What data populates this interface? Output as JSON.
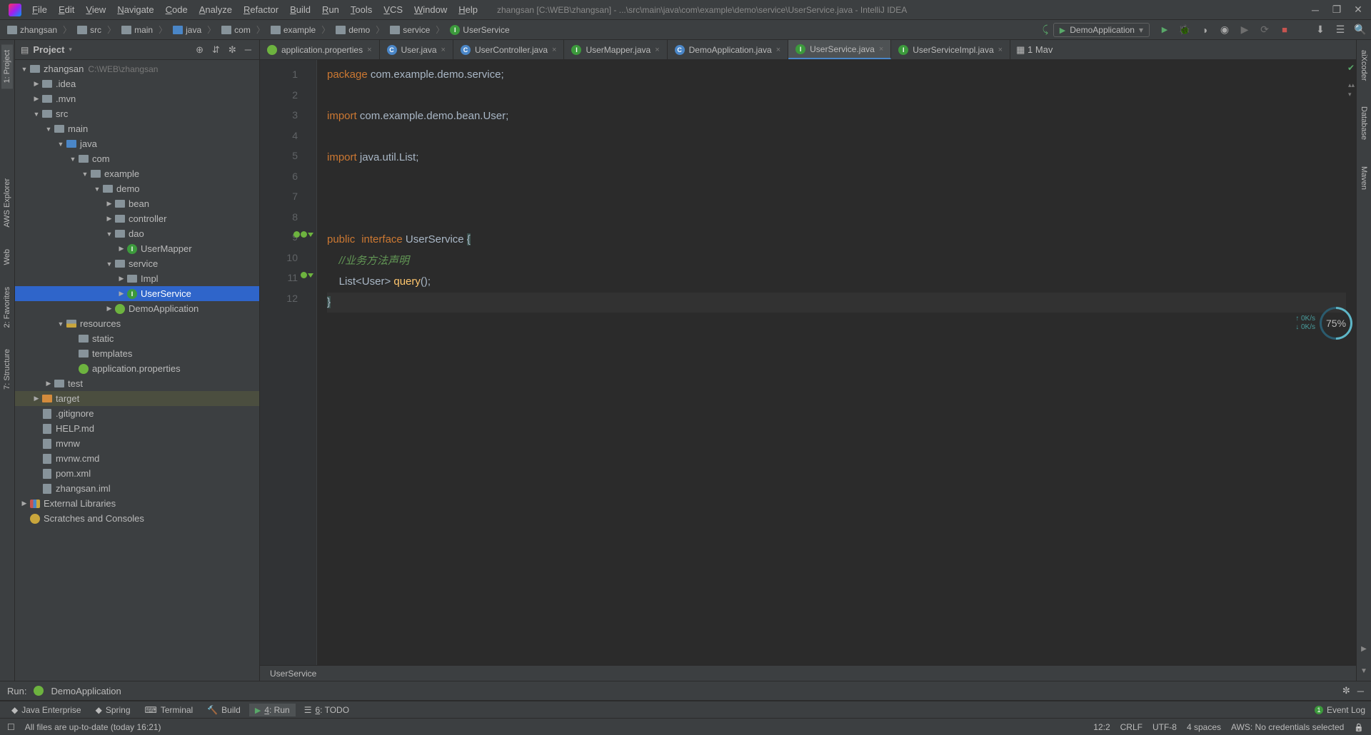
{
  "title": "zhangsan [C:\\WEB\\zhangsan] - ...\\src\\main\\java\\com\\example\\demo\\service\\UserService.java - IntelliJ IDEA",
  "menu": [
    "File",
    "Edit",
    "View",
    "Navigate",
    "Code",
    "Analyze",
    "Refactor",
    "Build",
    "Run",
    "Tools",
    "VCS",
    "Window",
    "Help"
  ],
  "breadcrumbs": [
    "zhangsan",
    "src",
    "main",
    "java",
    "com",
    "example",
    "demo",
    "service",
    "UserService"
  ],
  "runConfig": "DemoApplication",
  "projectPanel": {
    "title": "Project"
  },
  "tree": [
    {
      "d": 0,
      "exp": "down",
      "ico": "dir",
      "label": "zhangsan",
      "dim": "C:\\WEB\\zhangsan"
    },
    {
      "d": 1,
      "exp": "right",
      "ico": "dir",
      "label": ".idea"
    },
    {
      "d": 1,
      "exp": "right",
      "ico": "dir",
      "label": ".mvn"
    },
    {
      "d": 1,
      "exp": "down",
      "ico": "dir",
      "label": "src"
    },
    {
      "d": 2,
      "exp": "down",
      "ico": "dir",
      "label": "main"
    },
    {
      "d": 3,
      "exp": "down",
      "ico": "dir-blue",
      "label": "java"
    },
    {
      "d": 4,
      "exp": "down",
      "ico": "dir",
      "label": "com"
    },
    {
      "d": 5,
      "exp": "down",
      "ico": "dir",
      "label": "example"
    },
    {
      "d": 6,
      "exp": "down",
      "ico": "dir",
      "label": "demo"
    },
    {
      "d": 7,
      "exp": "right",
      "ico": "dir",
      "label": "bean"
    },
    {
      "d": 7,
      "exp": "right",
      "ico": "dir",
      "label": "controller"
    },
    {
      "d": 7,
      "exp": "down",
      "ico": "dir",
      "label": "dao"
    },
    {
      "d": 8,
      "exp": "right",
      "ico": "int",
      "label": "UserMapper"
    },
    {
      "d": 7,
      "exp": "down",
      "ico": "dir",
      "label": "service"
    },
    {
      "d": 8,
      "exp": "right",
      "ico": "dir",
      "label": "Impl"
    },
    {
      "d": 8,
      "exp": "right",
      "ico": "int",
      "label": "UserService",
      "sel": true
    },
    {
      "d": 7,
      "exp": "right",
      "ico": "spring",
      "label": "DemoApplication"
    },
    {
      "d": 3,
      "exp": "down",
      "ico": "res",
      "label": "resources"
    },
    {
      "d": 4,
      "exp": "",
      "ico": "dir",
      "label": "static"
    },
    {
      "d": 4,
      "exp": "",
      "ico": "dir",
      "label": "templates"
    },
    {
      "d": 4,
      "exp": "",
      "ico": "spring",
      "label": "application.properties"
    },
    {
      "d": 2,
      "exp": "right",
      "ico": "dir",
      "label": "test"
    },
    {
      "d": 1,
      "exp": "right",
      "ico": "dir-orange",
      "label": "target",
      "hl": true
    },
    {
      "d": 1,
      "exp": "",
      "ico": "file",
      "label": ".gitignore"
    },
    {
      "d": 1,
      "exp": "",
      "ico": "file",
      "label": "HELP.md"
    },
    {
      "d": 1,
      "exp": "",
      "ico": "file",
      "label": "mvnw"
    },
    {
      "d": 1,
      "exp": "",
      "ico": "file",
      "label": "mvnw.cmd"
    },
    {
      "d": 1,
      "exp": "",
      "ico": "file",
      "label": "pom.xml"
    },
    {
      "d": 1,
      "exp": "",
      "ico": "file",
      "label": "zhangsan.iml"
    },
    {
      "d": 0,
      "exp": "right",
      "ico": "lib",
      "label": "External Libraries"
    },
    {
      "d": 0,
      "exp": "",
      "ico": "scratch",
      "label": "Scratches and Consoles"
    }
  ],
  "tabs": [
    {
      "ico": "spring",
      "label": "application.properties"
    },
    {
      "ico": "class",
      "label": "User.java"
    },
    {
      "ico": "class",
      "label": "UserController.java"
    },
    {
      "ico": "int",
      "label": "UserMapper.java"
    },
    {
      "ico": "class",
      "label": "DemoApplication.java"
    },
    {
      "ico": "int",
      "label": "UserService.java",
      "active": true
    },
    {
      "ico": "int",
      "label": "UserServiceImpl.java"
    }
  ],
  "tabsMore": "▦ 1  Mav",
  "code": {
    "l1": {
      "kw": "package",
      "rest": " com.example.demo.service;"
    },
    "l3": {
      "kw": "import",
      "rest": " com.example.demo.bean.User;"
    },
    "l5": {
      "kw": "import",
      "rest": " java.util.List;"
    },
    "l9": {
      "kw1": "public",
      "kw2": "interface",
      "name": " UserService ",
      "brace": "{"
    },
    "l10": "    //业务方法声明",
    "l11": {
      "indent": "    ",
      "type": "List<User> ",
      "call": "query",
      "rest": "();"
    },
    "l12": "}"
  },
  "editorCrumb": "UserService",
  "run": {
    "label": "Run:",
    "config": "DemoApplication"
  },
  "bottomTabs": [
    "Java Enterprise",
    "Spring",
    "Terminal",
    "Build",
    "4: Run",
    "6: TODO"
  ],
  "eventLog": "Event Log",
  "status": {
    "msg": "All files are up-to-date (today 16:21)",
    "pos": "12:2",
    "eol": "CRLF",
    "enc": "UTF-8",
    "indent": "4 spaces",
    "aws": "AWS: No credentials selected"
  },
  "leftTabs": [
    "1: Project",
    "AWS Explorer",
    "Web",
    "2: Favorites",
    "7: Structure"
  ],
  "rightTabs": [
    "aiXcoder",
    "Database",
    "Maven"
  ],
  "mem": {
    "up": "↑ 0K/s",
    "down": "↓ 0K/s",
    "pct": "75%"
  }
}
